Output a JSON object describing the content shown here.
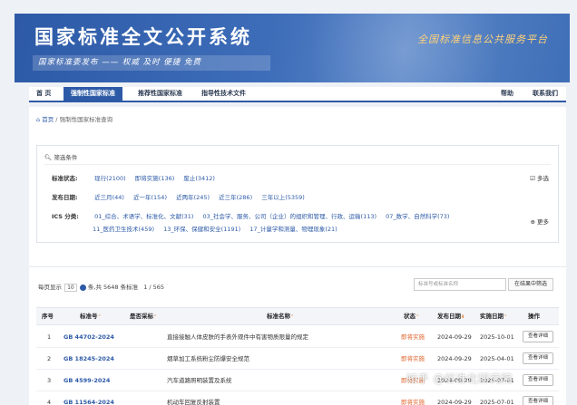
{
  "banner": {
    "title": "国家标准全文公开系统",
    "subtitle": "国家标准委发布 —— 权威 及时 便捷 免费",
    "slogan": "全国标准信息公共服务平台"
  },
  "nav": {
    "items": [
      "首 页",
      "强制性国家标准",
      "推荐性国家标准",
      "指导性技术文件"
    ],
    "active_index": 1,
    "right_items": [
      "帮助",
      "联系我们"
    ]
  },
  "breadcrumb": {
    "home": "首页",
    "sep": "/",
    "current": "强制性国家标准查询"
  },
  "filter": {
    "title": "筛选条件",
    "status_label": "标准状态:",
    "status_options": [
      "现行(2100)",
      "即将实施(136)",
      "废止(3412)"
    ],
    "multi_select": "多选",
    "date_label": "发布日期:",
    "date_options": [
      "近三月(44)",
      "近一年(154)",
      "近两年(245)",
      "近三年(286)",
      "三年以上(5359)"
    ],
    "ics_label": "ICS 分类:",
    "ics_row1": [
      "01_综合、术语学、标准化、文献(31)",
      "03_社会学、服务、公司（企业）的组织和管理、行政、运输(113)",
      "07_数学、自然科学(73)"
    ],
    "ics_row2": [
      "11_医药卫生技术(459)",
      "13_环保、保健和安全(1191)",
      "17_计量学和测量、物理现象(21)"
    ],
    "more": "更多"
  },
  "list": {
    "per_page_prefix": "每页显示",
    "per_page_value": "10",
    "summary": "条,共 5648 条标准",
    "page": "1 / 565",
    "search_placeholder": "标准号或标准名称",
    "search_button": "在结果中筛选",
    "headers": [
      "序号",
      "标准号",
      "是否采标",
      "标准名称",
      "状态",
      "发布日期",
      "实施日期",
      "操作"
    ],
    "rows": [
      {
        "no": "1",
        "code": "GB 44702-2024",
        "adopt": "",
        "name": "直接接触人体皮肤的手表外观件中有害物质限量的规定",
        "status": "即将实施",
        "pub": "2024-09-29",
        "impl": "2025-10-01",
        "action": "查看详细"
      },
      {
        "no": "2",
        "code": "GB 18245-2024",
        "adopt": "",
        "name": "烟草加工系统粉尘防爆安全规范",
        "status": "即将实施",
        "pub": "2024-09-29",
        "impl": "2025-04-01",
        "action": "查看详细"
      },
      {
        "no": "3",
        "code": "GB 4599-2024",
        "adopt": "",
        "name": "汽车道路照明装置及系统",
        "status": "即将实施",
        "pub": "2024-09-29",
        "impl": "2025-07-01",
        "action": "查看详细"
      },
      {
        "no": "4",
        "code": "GB 11564-2024",
        "adopt": "",
        "name": "机动车回复反射装置",
        "status": "即将实施",
        "pub": "2024-09-29",
        "impl": "2025-07-01",
        "action": "查看详细"
      }
    ]
  },
  "watermark": "知乎 @标准化研究院",
  "colors": {
    "primary": "#2d5aa7",
    "status_orange": "#e0662e",
    "slogan_gold": "#ffd27a"
  }
}
